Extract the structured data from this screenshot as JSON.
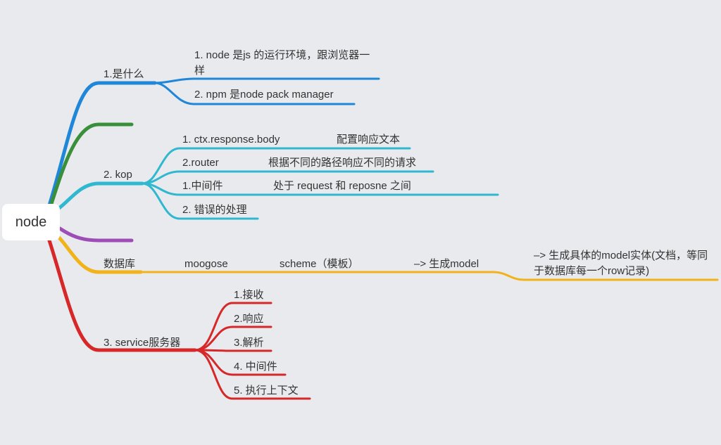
{
  "root": {
    "label": "node"
  },
  "colors": {
    "blue": "#1f86d8",
    "green": "#3a8f3a",
    "cyan": "#2fb8cf",
    "purple": "#9d4db5",
    "orange": "#f2b21a",
    "red": "#d62828"
  },
  "branches": {
    "what": {
      "label": "1.是什么",
      "items": [
        "1. node 是js 的运行环境，跟浏览器一样",
        "2. npm 是node pack manager"
      ]
    },
    "kop": {
      "label": "2. kop",
      "items": [
        {
          "label": "1. ctx.response.body",
          "detail": "配置响应文本"
        },
        {
          "label": "2.router",
          "detail": "根据不同的路径响应不同的请求"
        },
        {
          "label": "1.中间件",
          "detail": "处于 request 和 reposne 之间"
        },
        {
          "label": "2. 错误的处理",
          "detail": ""
        }
      ]
    },
    "database": {
      "label": "数据库",
      "chain": [
        "moogose",
        "scheme（模板）",
        "–> 生成model",
        "–> 生成具体的model实体(文档，等同于数据库每一个row记录)"
      ]
    },
    "service": {
      "label": "3. service服务器",
      "items": [
        "1.接收",
        "2.响应",
        "3.解析",
        "4. 中间件",
        "5. 执行上下文"
      ]
    }
  }
}
